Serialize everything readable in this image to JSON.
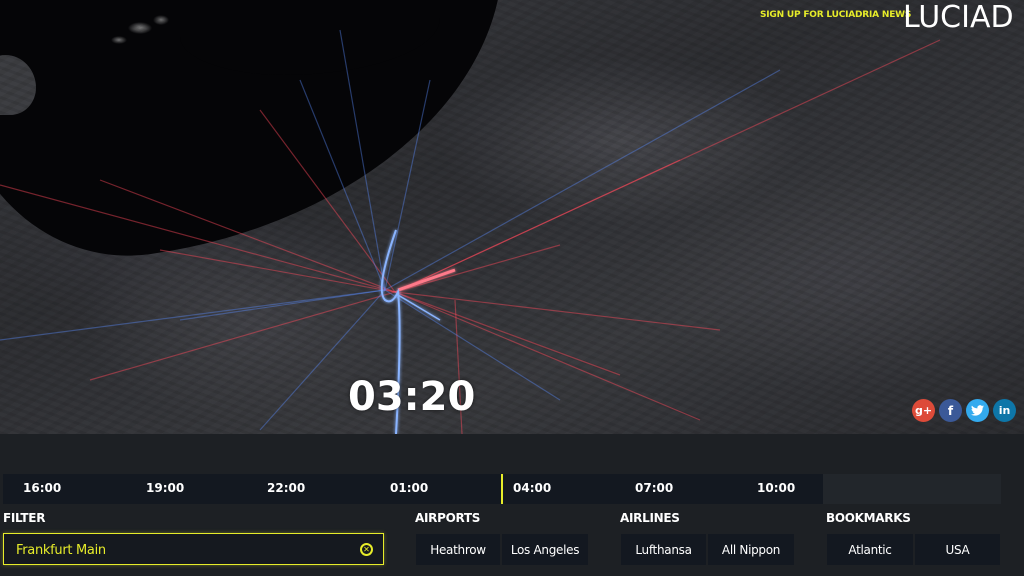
{
  "header": {
    "signup_link": "SIGN UP FOR LUCIADRIA NEWS",
    "logo": "LUCIAD"
  },
  "map": {
    "current_time": "03:20",
    "route_colors": {
      "arrivals": "#5a8cff",
      "departures": "#ff4a5a"
    }
  },
  "social": [
    {
      "name": "google-plus",
      "glyph": "g+",
      "color": "#dd4b39"
    },
    {
      "name": "facebook",
      "glyph": "f",
      "color": "#3b5998"
    },
    {
      "name": "twitter",
      "glyph": "t",
      "color": "#33aaee"
    },
    {
      "name": "linkedin",
      "glyph": "in",
      "color": "#0e76a8"
    }
  ],
  "timeline": {
    "ticks": [
      "16:00",
      "19:00",
      "22:00",
      "01:00",
      "04:00",
      "07:00",
      "10:00"
    ],
    "cursor_time": "03:20",
    "accent": "#e6ec2a"
  },
  "filter": {
    "label": "FILTER",
    "value": "Frankfurt Main",
    "clear_icon": "⊗"
  },
  "airports": {
    "label": "AIRPORTS",
    "items": [
      "Heathrow",
      "Los Angeles"
    ]
  },
  "airlines": {
    "label": "AIRLINES",
    "items": [
      "Lufthansa",
      "All Nippon"
    ]
  },
  "bookmarks": {
    "label": "BOOKMARKS",
    "items": [
      "Atlantic",
      "USA"
    ]
  }
}
